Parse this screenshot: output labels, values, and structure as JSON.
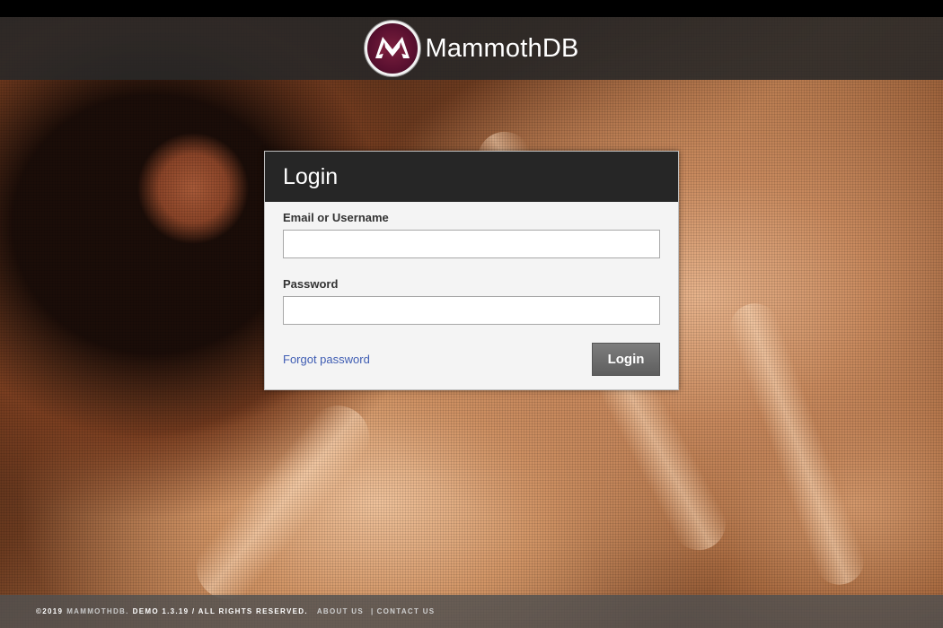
{
  "brand": {
    "name": "MammothDB",
    "logo_icon": "mammothdb-m-logo-icon",
    "logo_color": "#6a1535"
  },
  "login": {
    "title": "Login",
    "email_label": "Email or Username",
    "email_value": "",
    "password_label": "Password",
    "password_value": "",
    "forgot_label": "Forgot password",
    "submit_label": "Login",
    "link_color": "#3f5db3"
  },
  "footer": {
    "copyright": "©2019",
    "brand": "MAMMOTHDB.",
    "version": "DEMO 1.3.19 / ALL RIGHTS RESERVED.",
    "about_label": "ABOUT US",
    "separator": "|",
    "contact_label": "CONTACT US"
  }
}
